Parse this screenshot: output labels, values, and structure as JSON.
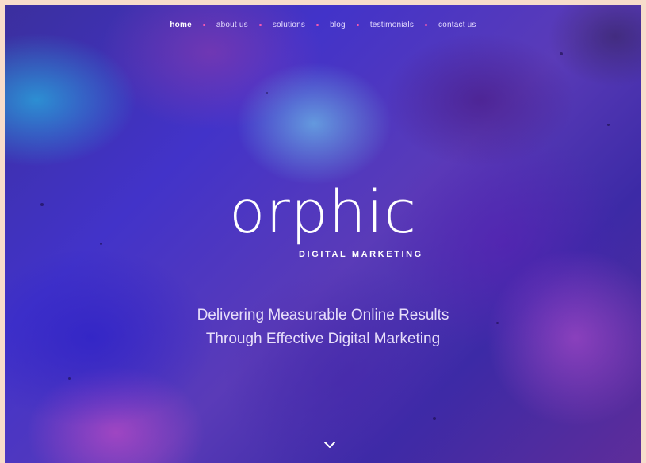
{
  "nav": {
    "items": [
      {
        "label": "home",
        "active": true
      },
      {
        "label": "about us"
      },
      {
        "label": "solutions"
      },
      {
        "label": "blog"
      },
      {
        "label": "testimonials"
      },
      {
        "label": "contact us"
      }
    ]
  },
  "logo": {
    "word": "orphic",
    "sub": "DIGITAL MARKETING"
  },
  "hero": {
    "tagline_line1": "Delivering Measurable Online Results",
    "tagline_line2": "Through Effective Digital Marketing",
    "scroll_icon": "chevron-down-icon"
  },
  "colors": {
    "accent_dot": "#ff5ab0",
    "frame": "#f7dccb",
    "text": "#ffffff"
  }
}
